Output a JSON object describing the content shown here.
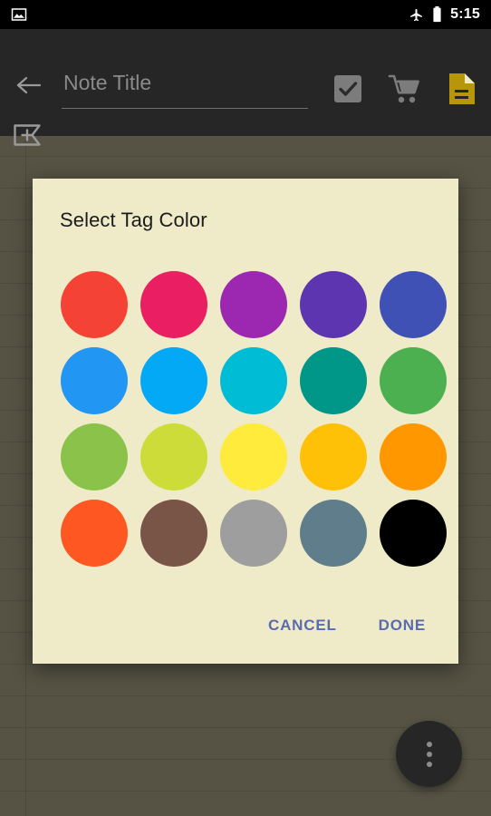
{
  "status_bar": {
    "notification_icon": "image-icon",
    "airplane_icon": "airplane-mode-icon",
    "battery_icon": "battery-icon",
    "time": "5:15",
    "background": "#000000"
  },
  "toolbar": {
    "back_icon": "back-arrow-icon",
    "title_placeholder": "Note Title",
    "title_value": "",
    "actions": [
      {
        "name": "checklist-button",
        "icon": "checkbox-checked-icon",
        "color": "#7C7C7C"
      },
      {
        "name": "shopping-list-button",
        "icon": "shopping-cart-icon",
        "color": "#7C7C7C"
      },
      {
        "name": "note-type-button",
        "icon": "document-icon",
        "color": "#B8960C"
      }
    ],
    "add_tag_icon": "add-tag-icon",
    "background": "#262626"
  },
  "dialog": {
    "title": "Select Tag Color",
    "background": "#EFEBC9",
    "title_color": "#1C1C1C",
    "button_color": "#5A6BB0",
    "cancel_label": "CANCEL",
    "done_label": "DONE",
    "swatches": [
      {
        "name": "red",
        "hex": "#F44336"
      },
      {
        "name": "pink",
        "hex": "#E91E63"
      },
      {
        "name": "purple",
        "hex": "#9C27B0"
      },
      {
        "name": "deep-purple",
        "hex": "#5E35B1"
      },
      {
        "name": "indigo",
        "hex": "#3F51B5"
      },
      {
        "name": "blue",
        "hex": "#2196F3"
      },
      {
        "name": "light-blue",
        "hex": "#03A9F4"
      },
      {
        "name": "cyan",
        "hex": "#00BCD4"
      },
      {
        "name": "teal",
        "hex": "#009688"
      },
      {
        "name": "green",
        "hex": "#4CAF50"
      },
      {
        "name": "light-green",
        "hex": "#8BC34A"
      },
      {
        "name": "lime",
        "hex": "#CDDC39"
      },
      {
        "name": "yellow",
        "hex": "#FFEB3B"
      },
      {
        "name": "amber",
        "hex": "#FFC107"
      },
      {
        "name": "orange",
        "hex": "#FF9800"
      },
      {
        "name": "deep-orange",
        "hex": "#FF5722"
      },
      {
        "name": "brown",
        "hex": "#795548"
      },
      {
        "name": "grey",
        "hex": "#9E9E9E"
      },
      {
        "name": "blue-grey",
        "hex": "#607D8B"
      },
      {
        "name": "black",
        "hex": "#000000"
      }
    ]
  },
  "fab": {
    "icon": "overflow-menu-icon",
    "background": "#262626"
  },
  "background": {
    "paper_color": "#6A6654",
    "scrim": "rgba(0,0,0,0.18)"
  }
}
